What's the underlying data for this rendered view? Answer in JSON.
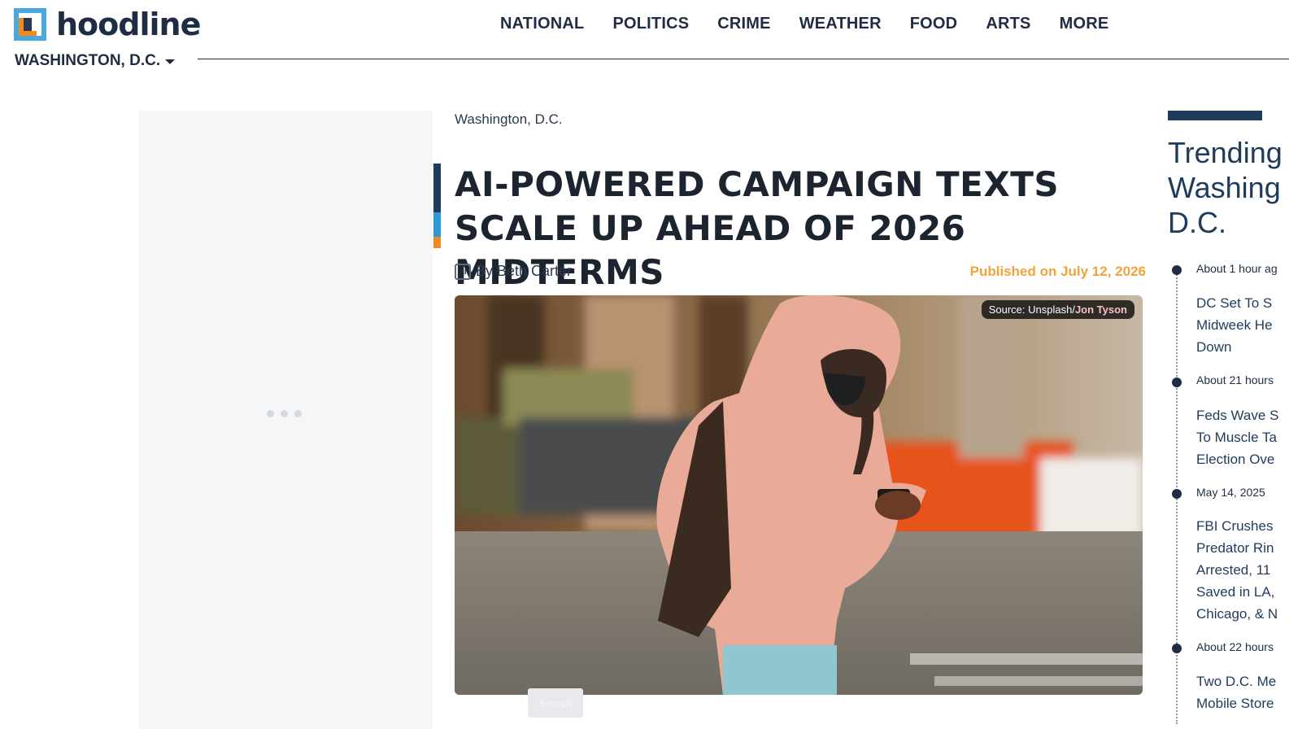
{
  "brand": {
    "name": "hoodline",
    "city": "WASHINGTON, D.C."
  },
  "nav": [
    "NATIONAL",
    "POLITICS",
    "CRIME",
    "WEATHER",
    "FOOD",
    "ARTS",
    "MORE"
  ],
  "article": {
    "breadcrumb": "Washington, D.C.",
    "headline": "AI-POWERED CAMPAIGN TEXTS SCALE UP AHEAD OF 2026 MIDTERMS",
    "ai_badge": "AI",
    "byline": "By Beth Carter",
    "published": "Published on July 12, 2026",
    "image_credit_prefix": "Source: Unsplash/",
    "image_credit_author": "Jon Tyson"
  },
  "search_button": "Search",
  "trending": {
    "title_lines": [
      "Trending",
      "Washing",
      "D.C."
    ],
    "items": [
      {
        "time": "About 1 hour ag",
        "lines": [
          "DC Set To S",
          "Midweek He",
          "Down"
        ]
      },
      {
        "time": "About 21 hours",
        "lines": [
          "Feds Wave S",
          "To Muscle Ta",
          "Election Ove"
        ]
      },
      {
        "time": "May 14, 2025",
        "lines": [
          "FBI Crushes",
          "Predator Rin",
          "Arrested, 11",
          "Saved in LA,",
          "Chicago, & N"
        ]
      },
      {
        "time": "About 22 hours",
        "lines": [
          "Two D.C. Me",
          "Mobile Store"
        ]
      }
    ]
  },
  "colors": {
    "navy": "#1f2d44",
    "accent_orange": "#f28b1f",
    "accent_blue": "#2c9ad6",
    "published": "#f2a33a"
  }
}
